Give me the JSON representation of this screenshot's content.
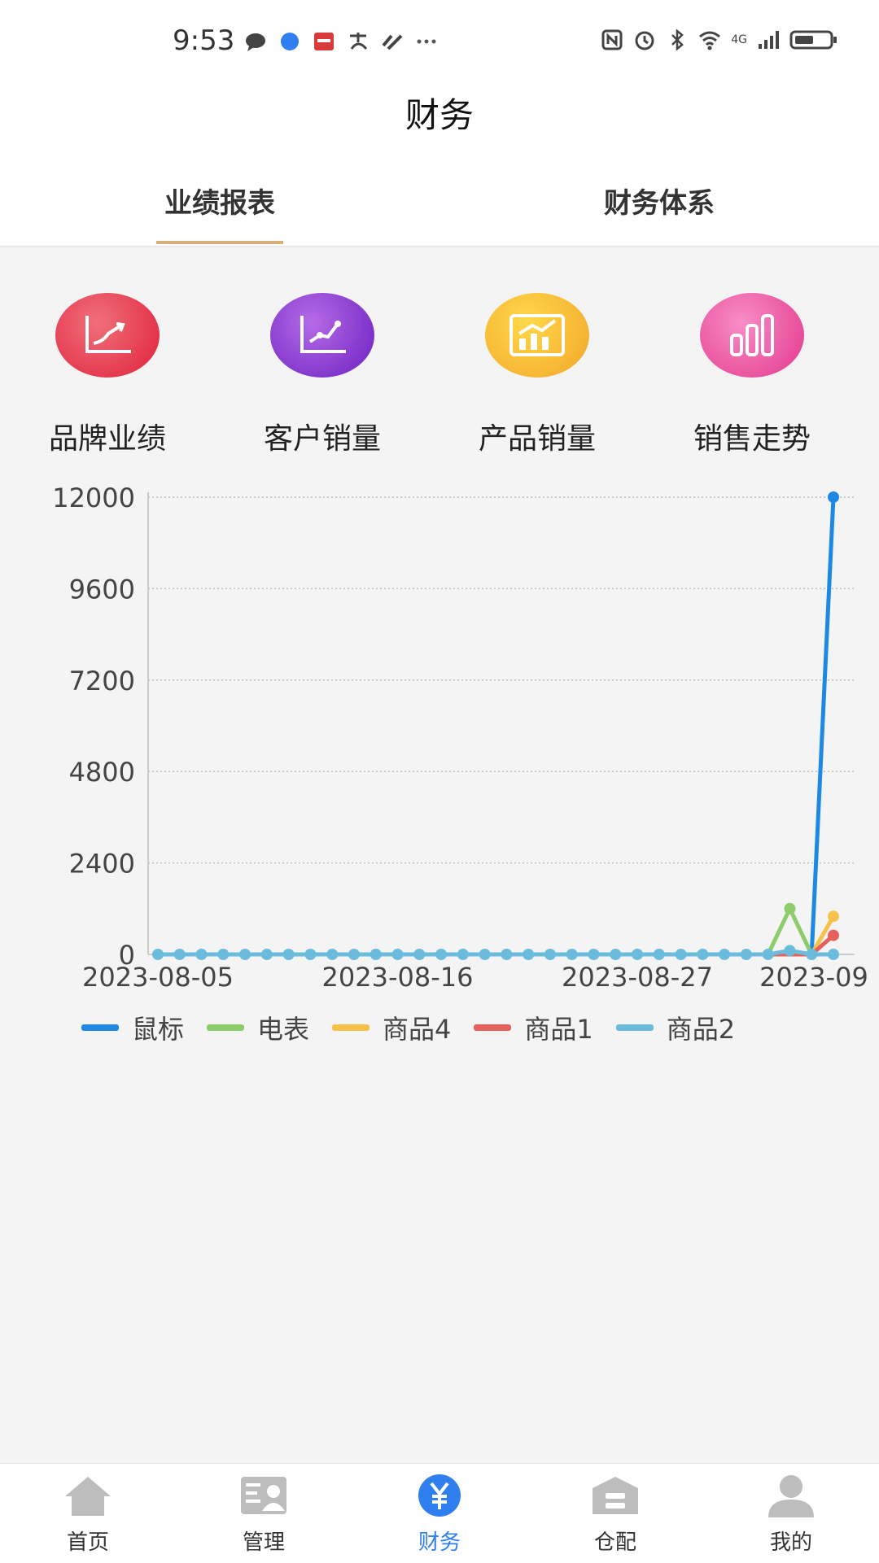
{
  "status_bar": {
    "time": "9:53",
    "network": "4G"
  },
  "header": {
    "title": "财务"
  },
  "tabs": [
    {
      "label": "业绩报表",
      "active": true
    },
    {
      "label": "财务体系",
      "active": false
    }
  ],
  "features": [
    {
      "label": "品牌业绩",
      "icon": "chart-up-icon",
      "color": "#e8354c"
    },
    {
      "label": "客户销量",
      "icon": "line-chart-icon",
      "color": "#8a33d6"
    },
    {
      "label": "产品销量",
      "icon": "growth-chart-icon",
      "color": "#f6b729"
    },
    {
      "label": "销售走势",
      "icon": "bar-chart-icon",
      "color": "#ec4f9e"
    }
  ],
  "chart_data": {
    "type": "line",
    "x_tick_labels": [
      "2023-08-05",
      "2023-08-16",
      "2023-08-27",
      "2023-09"
    ],
    "y_ticks": [
      0,
      2400,
      4800,
      7200,
      9600,
      12000
    ],
    "ylim": [
      0,
      12000
    ],
    "grid": true,
    "legend_position": "bottom",
    "points_count": 32,
    "series": [
      {
        "name": "鼠标",
        "color": "#1e88e5",
        "values": [
          0,
          0,
          0,
          0,
          0,
          0,
          0,
          0,
          0,
          0,
          0,
          0,
          0,
          0,
          0,
          0,
          0,
          0,
          0,
          0,
          0,
          0,
          0,
          0,
          0,
          0,
          0,
          0,
          0,
          0,
          0,
          12000
        ]
      },
      {
        "name": "电表",
        "color": "#8dcc6a",
        "values": [
          0,
          0,
          0,
          0,
          0,
          0,
          0,
          0,
          0,
          0,
          0,
          0,
          0,
          0,
          0,
          0,
          0,
          0,
          0,
          0,
          0,
          0,
          0,
          0,
          0,
          0,
          0,
          0,
          0,
          1200,
          0,
          0
        ]
      },
      {
        "name": "商品4",
        "color": "#f7c24a",
        "values": [
          0,
          0,
          0,
          0,
          0,
          0,
          0,
          0,
          0,
          0,
          0,
          0,
          0,
          0,
          0,
          0,
          0,
          0,
          0,
          0,
          0,
          0,
          0,
          0,
          0,
          0,
          0,
          0,
          0,
          0,
          0,
          1000
        ]
      },
      {
        "name": "商品1",
        "color": "#e8605d",
        "values": [
          0,
          0,
          0,
          0,
          0,
          0,
          0,
          0,
          0,
          0,
          0,
          0,
          0,
          0,
          0,
          0,
          0,
          0,
          0,
          0,
          0,
          0,
          0,
          0,
          0,
          0,
          0,
          0,
          0,
          0,
          0,
          500
        ]
      },
      {
        "name": "商品2",
        "color": "#6bbcdc",
        "values": [
          0,
          0,
          0,
          0,
          0,
          0,
          0,
          0,
          0,
          0,
          0,
          0,
          0,
          0,
          0,
          0,
          0,
          0,
          0,
          0,
          0,
          0,
          0,
          0,
          0,
          0,
          0,
          0,
          0,
          100,
          0,
          0
        ]
      }
    ]
  },
  "bottom_nav": [
    {
      "label": "首页",
      "icon": "home-icon",
      "active": false
    },
    {
      "label": "管理",
      "icon": "manage-icon",
      "active": false
    },
    {
      "label": "财务",
      "icon": "finance-icon",
      "active": true
    },
    {
      "label": "仓配",
      "icon": "warehouse-icon",
      "active": false
    },
    {
      "label": "我的",
      "icon": "profile-icon",
      "active": false
    }
  ],
  "colors": {
    "accent": "#2f7ff0",
    "tab_underline": "#d9b07a"
  }
}
